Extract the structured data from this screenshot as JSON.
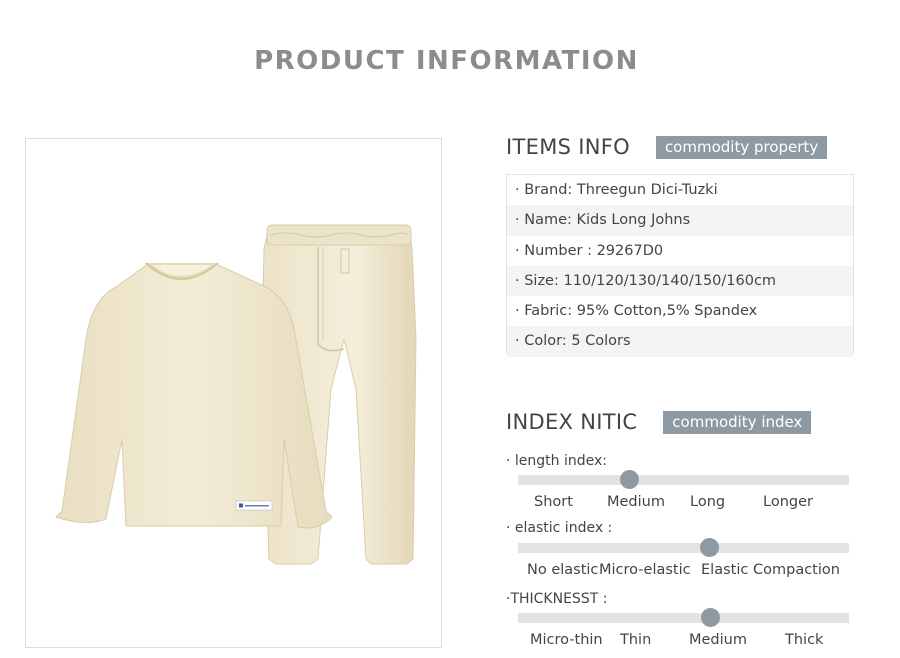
{
  "page": {
    "title": "PRODUCT INFORMATION"
  },
  "product_image": {
    "badge_text": "⁠"
  },
  "items_info": {
    "title": "ITEMS INFO",
    "tag": "commodity property",
    "rows": [
      "· Brand: Threegun Dici-Tuzki",
      "· Name: Kids Long Johns",
      "· Number : 29267D0",
      "· Size: 110/120/130/140/150/160cm",
      "· Fabric: 95% Cotton,5% Spandex",
      "· Color: 5 Colors"
    ]
  },
  "index_nitic": {
    "title": "INDEX NITIC",
    "tag": "commodity index",
    "scales": [
      {
        "label": "· length index:",
        "options": [
          "Short",
          "Medium",
          "Long",
          "Longer"
        ],
        "selected": "Medium"
      },
      {
        "label": "· elastic index :",
        "options": [
          "No elastic",
          "Micro-elastic",
          "Elastic",
          "Compaction"
        ],
        "selected": "Elastic"
      },
      {
        "label": "·THICKNESST :",
        "options": [
          "Micro-thin",
          "Thin",
          "Medium",
          "Thick"
        ],
        "selected": "Medium"
      }
    ]
  },
  "colors": {
    "accent": "#8e9aa3",
    "track": "#e3e3e3",
    "garment": "#f1ead2"
  }
}
